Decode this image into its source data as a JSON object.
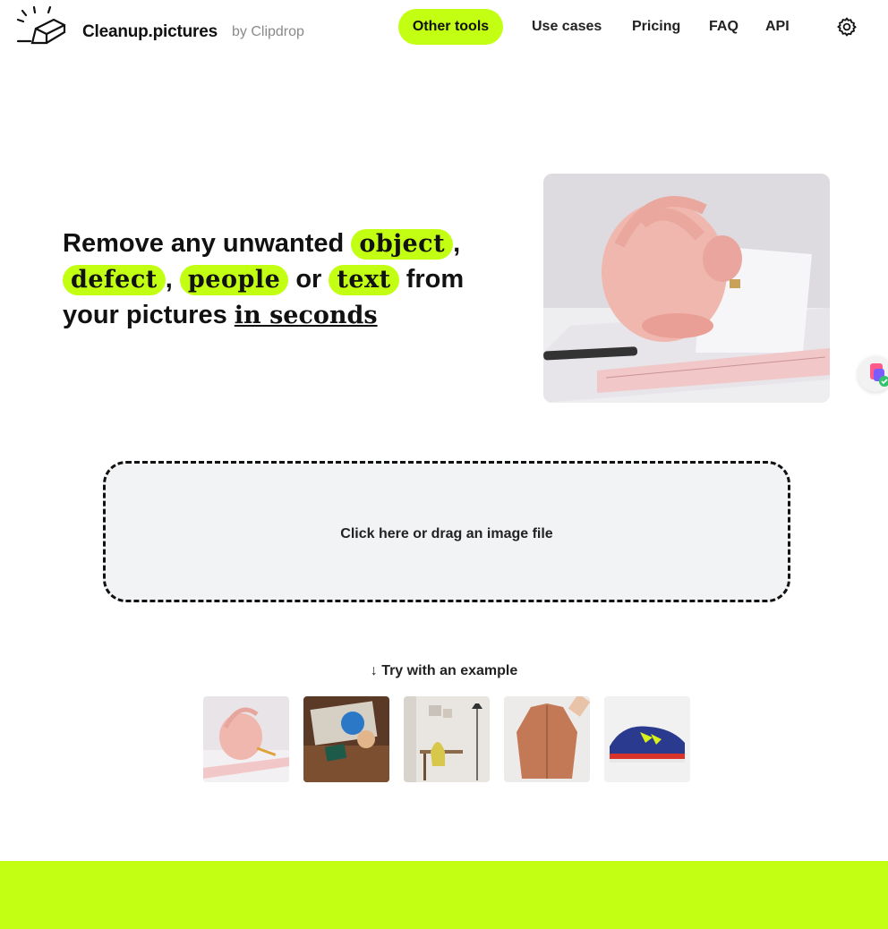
{
  "header": {
    "brand": "Cleanup.pictures",
    "by": "by Clipdrop",
    "other_tools": "Other tools",
    "nav": [
      "Use cases",
      "Pricing",
      "FAQ",
      "API"
    ],
    "settings_icon": "gear-icon"
  },
  "hero": {
    "line1_prefix": "Remove any unwanted",
    "chip_object": "object",
    "comma1": ",",
    "chip_defect": "defect",
    "comma2": ",",
    "chip_people": "people",
    "or": "or",
    "chip_text": "text",
    "from": "from",
    "line3_prefix": "your pictures",
    "underlined": "in seconds"
  },
  "dropzone": {
    "label": "Click here or drag an image file"
  },
  "examples": {
    "label": "Try with an example",
    "arrow_icon": "arrow-down-icon"
  },
  "colors": {
    "accent": "#c3ff12",
    "text": "#111111",
    "muted": "#8a8a8a",
    "dropzone_bg": "#f2f3f5"
  }
}
